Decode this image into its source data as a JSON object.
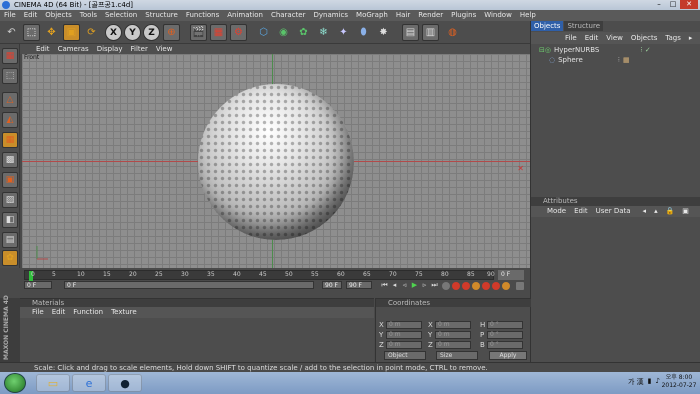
{
  "window": {
    "title": "CINEMA 4D (64 Bit) - [골프공1.c4d]",
    "controls": [
      "–",
      "□",
      "✕"
    ]
  },
  "menubar": [
    "File",
    "Edit",
    "Objects",
    "Tools",
    "Selection",
    "Structure",
    "Functions",
    "Animation",
    "Character",
    "Dynamics",
    "MoGraph",
    "Hair",
    "Render",
    "Plugins",
    "Window",
    "Help"
  ],
  "toolbar": {
    "tools": [
      "undo-icon",
      "select-icon",
      "move-icon",
      "scale-icon",
      "rotate-icon",
      "x-axis-icon",
      "y-axis-icon",
      "z-axis-icon",
      "coord-system-icon",
      "render-view-icon",
      "render-picture-icon",
      "render-settings-icon",
      "cube-icon",
      "nurbs-icon",
      "array-icon",
      "mograph-icon",
      "deformer-icon",
      "scene-icon",
      "light-icon",
      "camera-icon",
      "layout-icon",
      "python-icon"
    ],
    "axis_labels": [
      "X",
      "Y",
      "Z"
    ]
  },
  "viewport": {
    "menu": [
      "Edit",
      "Cameras",
      "Display",
      "Filter",
      "View"
    ],
    "label": "Front"
  },
  "timeline": {
    "ticks": [
      "0",
      "5",
      "10",
      "15",
      "20",
      "25",
      "30",
      "35",
      "40",
      "45",
      "50",
      "55",
      "60",
      "65",
      "70",
      "75",
      "80",
      "85",
      "90"
    ],
    "end_frame": "0 F",
    "current_frame": "0 F",
    "min_field": "0 F",
    "max_field": "90 F",
    "preview_end": "90 F"
  },
  "objects_panel": {
    "tabs": [
      "Objects",
      "Structure"
    ],
    "menu": [
      "File",
      "Edit",
      "View",
      "Objects",
      "Tags"
    ],
    "items": [
      {
        "name": "HyperNURBS",
        "indent": 0
      },
      {
        "name": "Sphere",
        "indent": 1
      }
    ]
  },
  "attributes_panel": {
    "title": "Attributes",
    "menu": [
      "Mode",
      "Edit",
      "User Data"
    ]
  },
  "materials_panel": {
    "title": "Materials",
    "menu": [
      "File",
      "Edit",
      "Function",
      "Texture"
    ]
  },
  "coordinates_panel": {
    "title": "Coordinates",
    "rows": [
      {
        "a": "X",
        "a_val": "0 m",
        "b": "X",
        "b_val": "0 m",
        "c": "H",
        "c_val": "0 °"
      },
      {
        "a": "Y",
        "a_val": "0 m",
        "b": "Y",
        "b_val": "0 m",
        "c": "P",
        "c_val": "0 °"
      },
      {
        "a": "Z",
        "a_val": "0 m",
        "b": "Z",
        "b_val": "0 m",
        "c": "B",
        "c_val": "0 °"
      }
    ],
    "mode_select": "Object",
    "size_select": "Size",
    "apply_label": "Apply"
  },
  "maxon_label": "MAXON CINEMA 4D",
  "status": "Scale: Click and drag to scale elements, Hold down SHIFT to quantize scale / add to the selection in point mode, CTRL to remove.",
  "taskbar": {
    "apps": [
      "file-explorer-icon",
      "internet-explorer-icon",
      "cinema4d-icon"
    ],
    "tray_text": "가 漢",
    "time": "오후 8:00",
    "date": "2012-07-27"
  }
}
